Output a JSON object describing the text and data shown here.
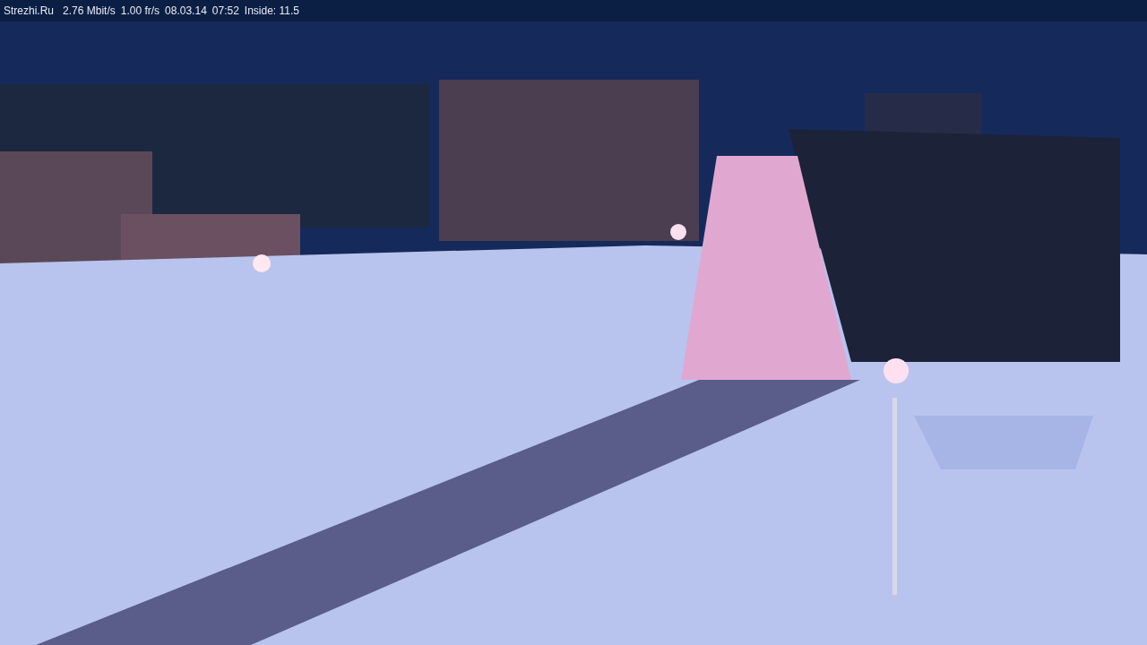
{
  "status_bar": {
    "site": "Strezhi.Ru",
    "bitrate": "2.76 Mbit/s",
    "frame_rate": "1.00 fr/s",
    "date": "08.03.14",
    "time": "07:52",
    "sensor": "Inside: 11.5"
  }
}
